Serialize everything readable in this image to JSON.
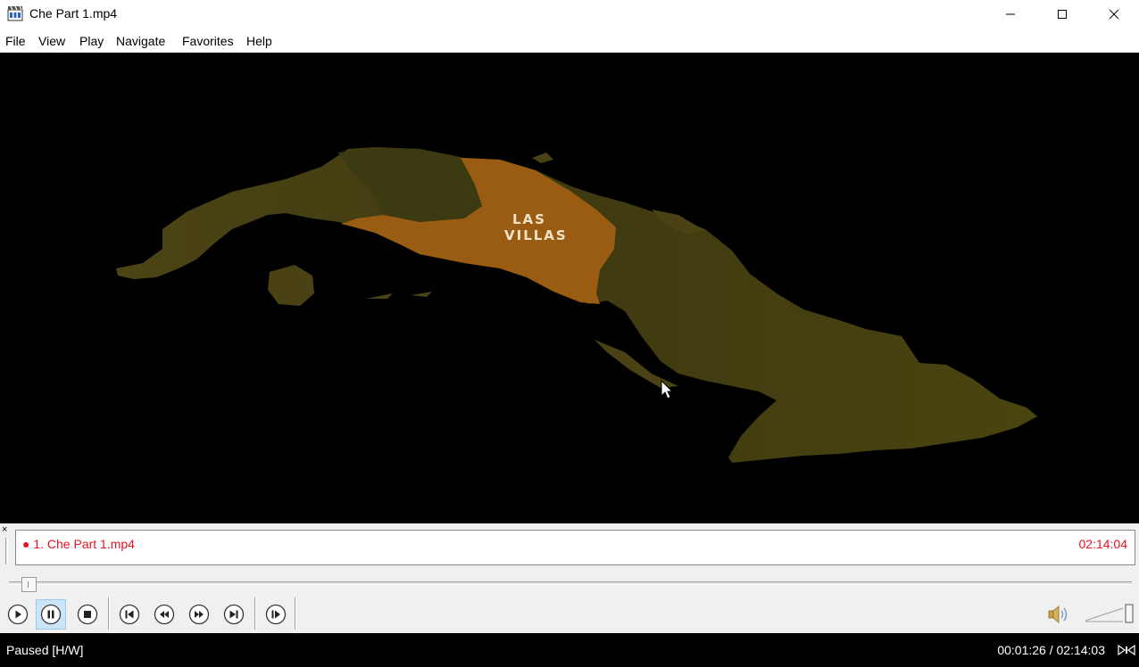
{
  "window": {
    "title": "Che Part 1.mp4",
    "app_icon": "media-player-clapper-icon",
    "controls": [
      "minimize-icon",
      "maximize-icon",
      "close-icon"
    ]
  },
  "menu": [
    {
      "label": "File"
    },
    {
      "label": "View"
    },
    {
      "label": "Play"
    },
    {
      "label": "Navigate"
    },
    {
      "label": "Favorites"
    },
    {
      "label": "Help"
    }
  ],
  "video": {
    "map_label_line1": "LAS",
    "map_label_line2": "VILLAS",
    "colors": {
      "background": "#000000",
      "highlight_region": "#b06a10",
      "land": "#4a4212"
    }
  },
  "playlist": {
    "close_glyph": "×",
    "items": [
      {
        "label": "● 1. Che Part 1.mp4",
        "duration": "02:14:04",
        "color": "#e81123"
      }
    ]
  },
  "seekbar": {
    "position_fraction": 0.011
  },
  "controls": {
    "buttons": [
      "play-icon",
      "pause-icon",
      "stop-icon",
      "skip-previous-icon",
      "rewind-icon",
      "fast-forward-icon",
      "skip-next-icon",
      "frame-step-icon"
    ],
    "active": "pause-icon",
    "volume_icon": "speaker-icon",
    "volume_level_fraction": 1.0
  },
  "status": {
    "state": "Paused [H/W]",
    "time": "00:01:26 / 02:14:03",
    "icon": "video-renderer-icon"
  }
}
